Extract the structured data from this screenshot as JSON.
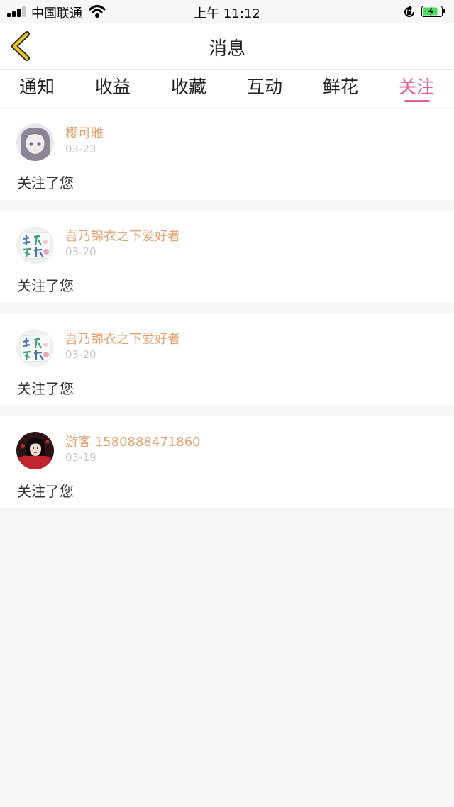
{
  "status_bar": {
    "carrier": "中国联通",
    "time": "上午 11:12",
    "battery_color": "#4cd964"
  },
  "nav": {
    "title": "消息",
    "back_icon_color": "#e6c229"
  },
  "tabs": [
    {
      "label": "通知"
    },
    {
      "label": "收益"
    },
    {
      "label": "收藏"
    },
    {
      "label": "互动"
    },
    {
      "label": "鲜花"
    },
    {
      "label": "关注",
      "active": true
    }
  ],
  "accent_color": "#e75c8f",
  "messages": [
    {
      "user": "樱可雅",
      "date": "03-23",
      "text": "关注了您",
      "avatar": "anime-girl-avatar"
    },
    {
      "user": "吾乃锦衣之下爱好者",
      "date": "03-20",
      "text": "关注了您",
      "avatar": "handwritten-avatar"
    },
    {
      "user": "吾乃锦衣之下爱好者",
      "date": "03-20",
      "text": "关注了您",
      "avatar": "handwritten-avatar"
    },
    {
      "user": "游客 1580888471860",
      "date": "03-19",
      "text": "关注了您",
      "avatar": "costume-portrait-avatar"
    }
  ]
}
